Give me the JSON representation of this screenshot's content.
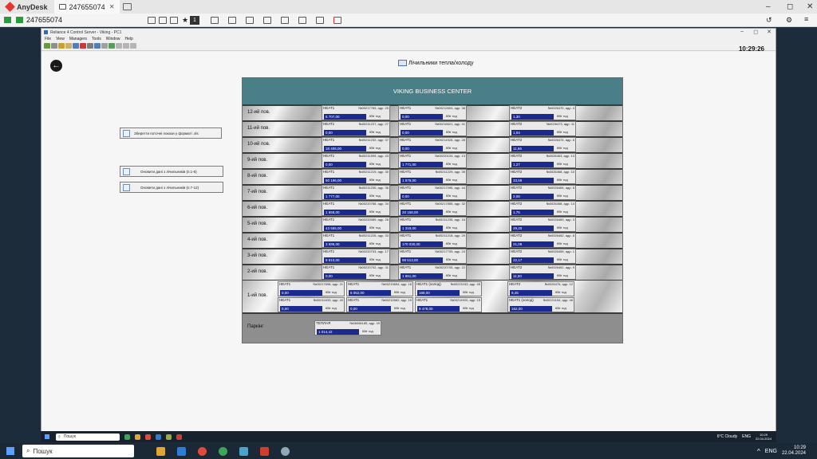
{
  "anydesk": {
    "app_name": "AnyDesk",
    "tab_label": "247655074",
    "address": "247655074",
    "toolbar_badge": "1"
  },
  "window": {
    "title": "Reliance 4 Control Server - Viking - PC1",
    "menu": [
      "File",
      "View",
      "Managers",
      "Tools",
      "Window",
      "Help"
    ],
    "clock": "10:29:26"
  },
  "page": {
    "title": "Лічильники тепла/холоду",
    "title_icon_text": "000"
  },
  "buttons": {
    "export": "Зберегти поточні покази у форматі .xls",
    "refresh_1": "Оновити дані з лічильників (п.1-6)",
    "refresh_2": "Оновити дані з лічильників (п.7-12)"
  },
  "panel": {
    "banner": "VIKING BUSINESS CENTER",
    "unit": "КВт год"
  },
  "floors": [
    {
      "label": "12-ий пов.",
      "meters": [
        {
          "name": "HEAT1",
          "id": "№00217769, адр. 25",
          "value": "6 707,00"
        },
        {
          "name": "HEAT1",
          "id": "№00212604, адр. 38",
          "value": "0,00"
        },
        {
          "name": "HEAT2",
          "id": "№0026470, адр. 4",
          "value": "1,30"
        }
      ]
    },
    {
      "label": "11-ий пов.",
      "meters": [
        {
          "name": "HEAT1",
          "id": "№00211227, адр. 27",
          "value": "0,00"
        },
        {
          "name": "HEAT1",
          "id": "№00216621, адр. 41",
          "value": "0,00"
        },
        {
          "name": "HEAT2",
          "id": "№0026473, адр. 11",
          "value": "1,04"
        }
      ]
    },
    {
      "label": "10-ий пов.",
      "meters": [
        {
          "name": "HEAT1",
          "id": "№00211232, адр. 37",
          "value": "18 405,00"
        },
        {
          "name": "HEAT1",
          "id": "№00214926, адр. 28",
          "value": "0,00"
        },
        {
          "name": "HEAT2",
          "id": "№0026474, адр. 6",
          "value": "11,66"
        }
      ]
    },
    {
      "label": "9-ий пов.",
      "meters": [
        {
          "name": "HEAT1",
          "id": "№00211599, адр. 43",
          "value": "0,00"
        },
        {
          "name": "HEAT1",
          "id": "№00220104, адр. 13",
          "value": "1 771,00"
        },
        {
          "name": "HEAT2",
          "id": "№0026463, адр. 13",
          "value": "1,27"
        }
      ]
    },
    {
      "label": "8-ий пов.",
      "meters": [
        {
          "name": "HEAT1",
          "id": "№00211219, адр. 30",
          "value": "60 196,00"
        },
        {
          "name": "HEAT1",
          "id": "№00211229, адр. 39",
          "value": "1 576,00"
        },
        {
          "name": "HEAT2",
          "id": "№0026468, адр. 10",
          "value": "33,59"
        }
      ]
    },
    {
      "label": "7-ий пов.",
      "meters": [
        {
          "name": "HEAT1",
          "id": "№00211230, адр. 36",
          "value": "1 777,00"
        },
        {
          "name": "HEAT1",
          "id": "№00217096, адр. 44",
          "value": "0,00"
        },
        {
          "name": "HEAT2",
          "id": "№0026464, адр. 8",
          "value": "2,08"
        }
      ]
    },
    {
      "label": "6-ий пов.",
      "meters": [
        {
          "name": "HEAT1",
          "id": "№00220766, адр. 34",
          "value": "1 658,00"
        },
        {
          "name": "HEAT1",
          "id": "№00217855, адр. 32",
          "value": "20 158,00"
        },
        {
          "name": "HEAT2",
          "id": "№0026458, адр. 14",
          "value": "1,75"
        }
      ]
    },
    {
      "label": "5-ий пов.",
      "meters": [
        {
          "name": "HEAT1",
          "id": "№00220089, адр. 26",
          "value": "43 555,00"
        },
        {
          "name": "HEAT1",
          "id": "№00211235, адр. 16",
          "value": "1 319,00"
        },
        {
          "name": "HEAT2",
          "id": "№0026460, адр. 3",
          "value": "29,20"
        }
      ]
    },
    {
      "label": "4-ий пов.",
      "meters": [
        {
          "name": "HEAT1",
          "id": "№00211226, адр. 33",
          "value": "3 595,00"
        },
        {
          "name": "HEAT1",
          "id": "№00211218, адр. 29",
          "value": "170 030,00"
        },
        {
          "name": "HEAT2",
          "id": "№0026462, адр. 8",
          "value": "21,08"
        }
      ]
    },
    {
      "label": "3-ий пов.",
      "meters": [
        {
          "name": "HEAT1",
          "id": "№00220703, адр. 17",
          "value": "9 810,00"
        },
        {
          "name": "HEAT1",
          "id": "№00217705, адр. 24",
          "value": "98 513,00"
        },
        {
          "name": "HEAT2",
          "id": "№0026459, адр. 1",
          "value": "22,17"
        }
      ]
    },
    {
      "label": "2-ий пов.",
      "meters": [
        {
          "name": "HEAT1",
          "id": "№00220702, адр. 31",
          "value": "0,00"
        },
        {
          "name": "HEAT1",
          "id": "№00220705, адр. 22",
          "value": "1 861,00"
        },
        {
          "name": "HEAT2",
          "id": "№0026461, адр. 9",
          "value": "11,50"
        }
      ]
    }
  ],
  "floor1": {
    "label": "1-ий пов.",
    "meters": [
      {
        "name": "HEAT1",
        "id": "№00217698, адр. 21",
        "value": "0,00"
      },
      {
        "name": "HEAT1",
        "id": "№00213654, адр. 18",
        "value": "6 052,00"
      },
      {
        "name": "HEAT1 (холод)",
        "id": "№00221153, адр. 45",
        "value": "168,00"
      },
      {
        "name": "HEAT2",
        "id": "№0026476, адр. 12",
        "value": "9,45"
      },
      {
        "name": "HEAT1",
        "id": "№00211633, адр. 40",
        "value": "0,00"
      },
      {
        "name": "HEAT1",
        "id": "№00212662, адр. 19",
        "value": "0,00"
      },
      {
        "name": "HEAT1",
        "id": "№00214920, адр. 15",
        "value": "9 478,00"
      },
      {
        "name": "HEAT1 (холод)",
        "id": "№00221154, адр. 46",
        "value": "162,00"
      }
    ]
  },
  "parking": {
    "label": "Паркінг",
    "meter": {
      "name": "ТЕПЛАЯ",
      "id": "№06066185, адр. 49",
      "value": "1 014,42"
    }
  },
  "remote_taskbar": {
    "search": "Пошук",
    "weather": "6°C Cloudy",
    "lang": "ENG",
    "time": "10:29",
    "date": "22.04.2024"
  },
  "local_taskbar": {
    "search": "Пошук",
    "lang": "ENG",
    "time": "10:29",
    "date": "22.04.2024"
  },
  "colors": {
    "banner": "#4b7f88",
    "value_bar": "#1b2a91",
    "anydesk_red": "#e5352d"
  }
}
